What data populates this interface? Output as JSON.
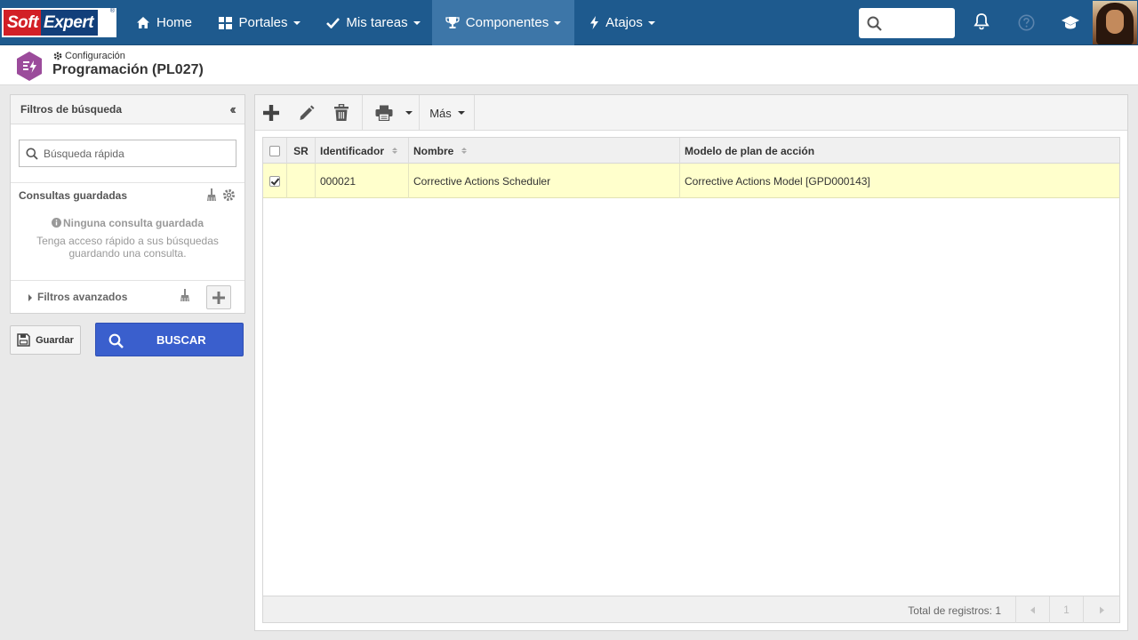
{
  "brand": {
    "part1": "Soft",
    "part2": "Expert",
    "reg": "®"
  },
  "nav": {
    "items": [
      {
        "label": "Home",
        "icon": "home-icon",
        "dropdown": false
      },
      {
        "label": "Portales",
        "icon": "grid-icon",
        "dropdown": true
      },
      {
        "label": "Mis tareas",
        "icon": "check-icon",
        "dropdown": true
      },
      {
        "label": "Componentes",
        "icon": "trophy-icon",
        "dropdown": true,
        "active": true
      },
      {
        "label": "Atajos",
        "icon": "bolt-icon",
        "dropdown": true
      }
    ],
    "search_placeholder": ""
  },
  "page": {
    "breadcrumb": "Configuración",
    "title": "Programación (PL027)"
  },
  "filters": {
    "title": "Filtros de búsqueda",
    "quick_search_placeholder": "Búsqueda rápida",
    "saved_title": "Consultas guardadas",
    "empty_title": "Ninguna consulta guardada",
    "empty_desc": "Tenga acceso rápido a sus búsquedas guardando una consulta.",
    "advanced_title": "Filtros avanzados",
    "save_label": "Guardar",
    "search_label": "BUSCAR"
  },
  "toolbar": {
    "more_label": "Más"
  },
  "grid": {
    "columns": [
      "SR",
      "Identificador",
      "Nombre",
      "Modelo de plan de acción"
    ],
    "rows": [
      {
        "checked": true,
        "sr": "",
        "id": "000021",
        "name": "Corrective Actions Scheduler",
        "model": "Corrective Actions Model [GPD000143]"
      }
    ],
    "total_label": "Total de registros: 1",
    "page": "1"
  },
  "colors": {
    "nav_bg": "#1e5a8e",
    "nav_active": "#3d76a8",
    "buscar_bg": "#3a5fcd",
    "selected_row": "#ffffcc",
    "logo_red": "#d21f26",
    "logo_blue": "#123f7a"
  }
}
